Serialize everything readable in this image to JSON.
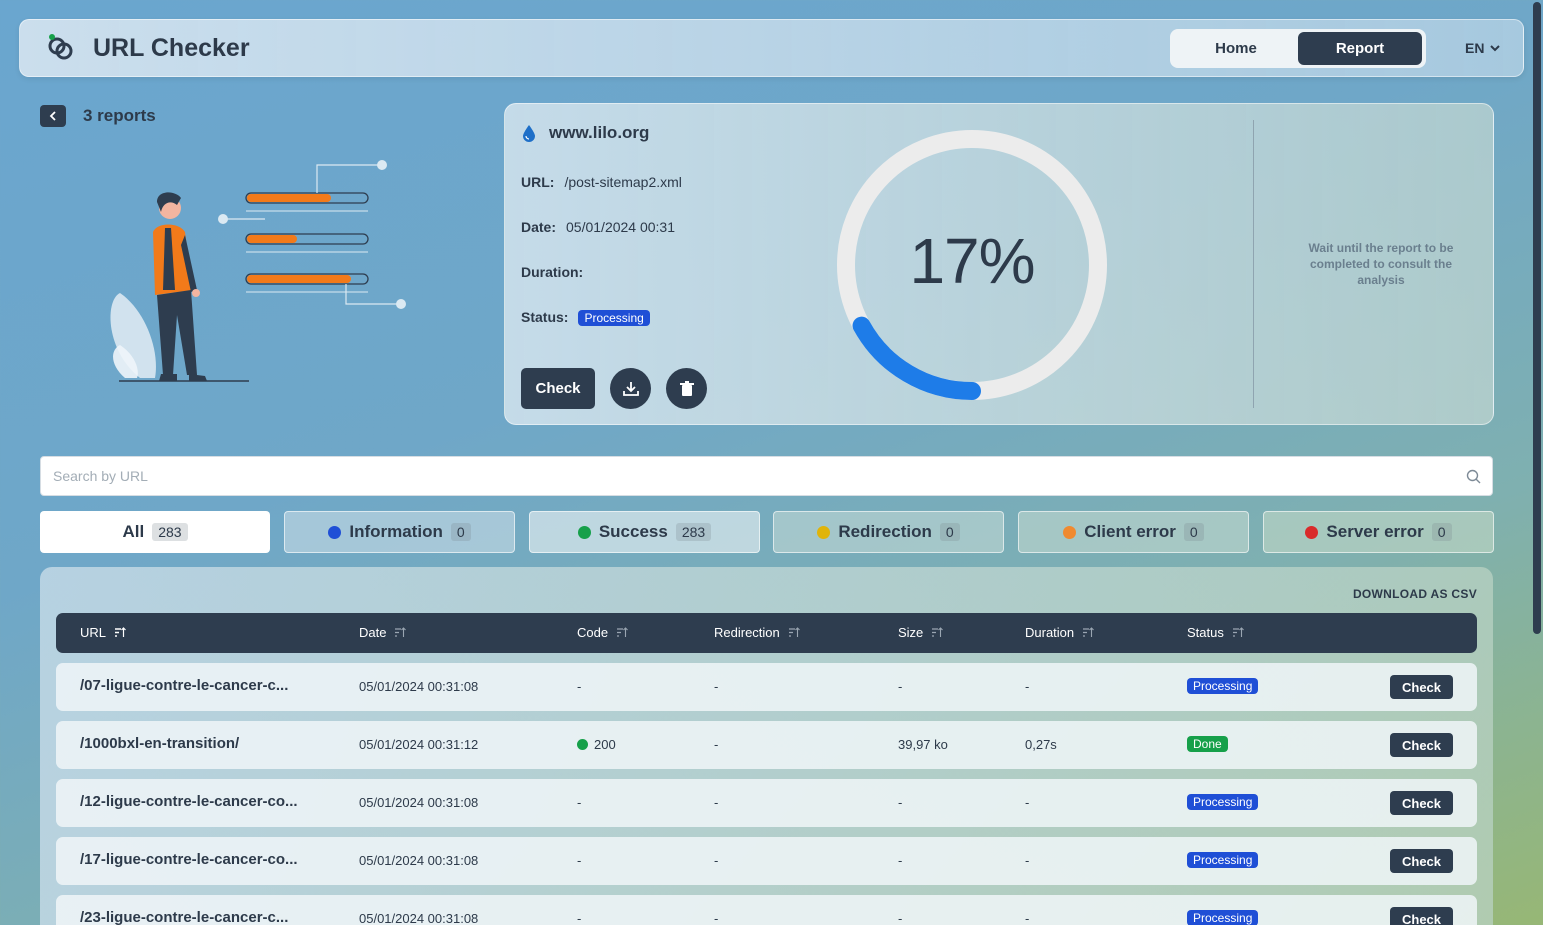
{
  "header": {
    "app_title": "URL Checker",
    "nav": {
      "home": "Home",
      "report": "Report",
      "active": "Report"
    },
    "language": "EN"
  },
  "reports": {
    "label": "3 reports"
  },
  "report": {
    "site": "www.lilo.org",
    "url_label": "URL:",
    "url_value": "/post-sitemap2.xml",
    "date_label": "Date:",
    "date_value": "05/01/2024 00:31",
    "duration_label": "Duration:",
    "duration_value": "",
    "status_label": "Status:",
    "status_value": "Processing",
    "check_label": "Check",
    "progress_percent": 17,
    "progress_text": "17%",
    "wait_message": "Wait until the report to be completed to consult the analysis"
  },
  "search": {
    "placeholder": "Search by URL",
    "value": ""
  },
  "filters": [
    {
      "label": "All",
      "count": "283",
      "color": ""
    },
    {
      "label": "Information",
      "count": "0",
      "color": "#1f4fd6"
    },
    {
      "label": "Success",
      "count": "283",
      "color": "#16a04a"
    },
    {
      "label": "Redirection",
      "count": "0",
      "color": "#e0b40a"
    },
    {
      "label": "Client error",
      "count": "0",
      "color": "#f08a30"
    },
    {
      "label": "Server error",
      "count": "0",
      "color": "#d92b2b"
    }
  ],
  "table": {
    "download_csv": "DOWNLOAD AS CSV",
    "columns": [
      "URL",
      "Date",
      "Code",
      "Redirection",
      "Size",
      "Duration",
      "Status"
    ],
    "check_label": "Check",
    "rows": [
      {
        "url": "/07-ligue-contre-le-cancer-c...",
        "date": "05/01/2024 00:31:08",
        "code": "-",
        "redirection": "-",
        "size": "-",
        "duration": "-",
        "status": "Processing"
      },
      {
        "url": "/1000bxl-en-transition/",
        "date": "05/01/2024 00:31:12",
        "code": "200",
        "redirection": "-",
        "size": "39,97 ko",
        "duration": "0,27s",
        "status": "Done"
      },
      {
        "url": "/12-ligue-contre-le-cancer-co...",
        "date": "05/01/2024 00:31:08",
        "code": "-",
        "redirection": "-",
        "size": "-",
        "duration": "-",
        "status": "Processing"
      },
      {
        "url": "/17-ligue-contre-le-cancer-co...",
        "date": "05/01/2024 00:31:08",
        "code": "-",
        "redirection": "-",
        "size": "-",
        "duration": "-",
        "status": "Processing"
      },
      {
        "url": "/23-ligue-contre-le-cancer-c...",
        "date": "05/01/2024 00:31:08",
        "code": "-",
        "redirection": "-",
        "size": "-",
        "duration": "-",
        "status": "Processing"
      }
    ]
  },
  "colors": {
    "primary": "#2e3d4f",
    "processing": "#1f4fd6",
    "done": "#16a04a",
    "progress": "#1e7ce8",
    "accent": "#f27a1a"
  }
}
